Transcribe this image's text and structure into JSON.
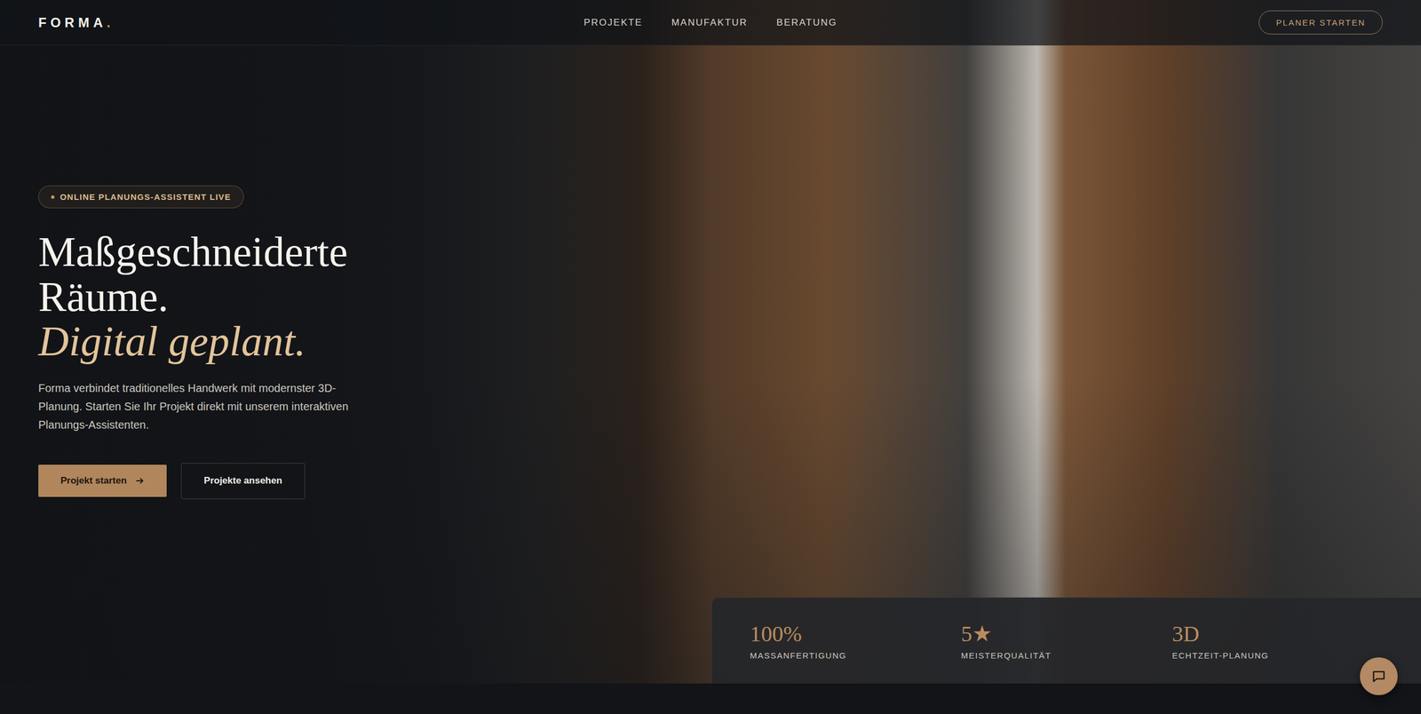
{
  "nav": {
    "logo": "FORMA",
    "logo_mark": ".",
    "links": [
      "PROJEKTE",
      "MANUFAKTUR",
      "BERATUNG"
    ],
    "cta": "PLANER STARTEN"
  },
  "hero": {
    "badge": "ONLINE PLANUNGS-ASSISTENT LIVE",
    "headline": [
      "Maßgeschneiderte",
      "Räume."
    ],
    "headline_accent": "Digital geplant.",
    "text": "Forma verbindet traditionelles Handwerk mit modernster 3D-Planung. Starten Sie Ihr Projekt direkt mit unserem interaktiven Planungs-Assistenten.",
    "buttons": [
      {
        "label": "Projekt starten",
        "kind": "primary"
      },
      {
        "label": "Projekte ansehen",
        "kind": "secondary"
      }
    ]
  },
  "stats": [
    {
      "value": "100%",
      "label": "MASSANFERTIGUNG"
    },
    {
      "value": "5★",
      "label": "MEISTERQUALITÄT"
    },
    {
      "value": "3D",
      "label": "ECHTZEIT-PLANUNG"
    }
  ]
}
